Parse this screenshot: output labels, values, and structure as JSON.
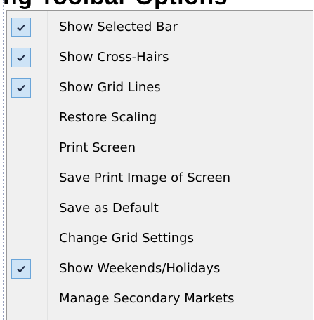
{
  "background": {
    "heading_fragment": "ng Toolbar Options"
  },
  "colors": {
    "menu_background": "#f0f0f0",
    "check_highlight": "#cde3f6",
    "check_border": "#6aa5d9",
    "check_mark": "#1f2a44"
  },
  "menu": {
    "items": [
      {
        "label": "Show Selected Bar",
        "checked": true,
        "icon": "check-icon"
      },
      {
        "label": "Show Cross-Hairs",
        "checked": true,
        "icon": "check-icon"
      },
      {
        "label": "Show Grid Lines",
        "checked": true,
        "icon": "check-icon"
      },
      {
        "label": "Restore Scaling",
        "checked": false
      },
      {
        "label": "Print Screen",
        "checked": false
      },
      {
        "label": "Save Print Image of Screen",
        "checked": false
      },
      {
        "label": "Save as Default",
        "checked": false
      },
      {
        "label": "Change Grid Settings",
        "checked": false
      },
      {
        "label": "Show Weekends/Holidays",
        "checked": true,
        "icon": "check-icon"
      },
      {
        "label": "Manage Secondary Markets",
        "checked": false
      }
    ]
  }
}
